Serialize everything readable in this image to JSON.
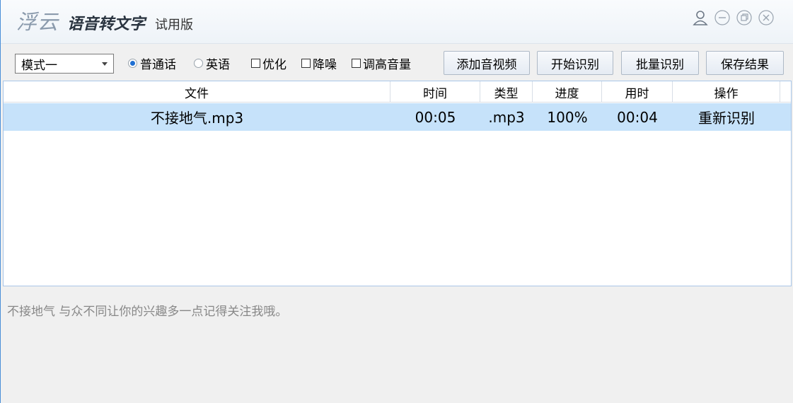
{
  "title_bar": {
    "logo": "浮云",
    "app_name": "语音转文字",
    "edition": "试用版",
    "controls": [
      "user-icon",
      "minimize-icon",
      "restore-icon",
      "close-icon"
    ]
  },
  "toolbar": {
    "mode_select": "模式一",
    "languages": [
      {
        "label": "普通话",
        "selected": true
      },
      {
        "label": "英语",
        "selected": false
      }
    ],
    "checkboxes": [
      {
        "label": "优化",
        "checked": false
      },
      {
        "label": "降噪",
        "checked": false
      },
      {
        "label": "调高音量",
        "checked": false
      }
    ],
    "buttons": {
      "add_media": "添加音视频",
      "start": "开始识别",
      "batch": "批量识别",
      "save": "保存结果"
    }
  },
  "table": {
    "columns": [
      "文件",
      "时间",
      "类型",
      "进度",
      "用时",
      "操作"
    ],
    "rows": [
      {
        "file": "不接地气.mp3",
        "time": "00:05",
        "type": ".mp3",
        "progress": "100%",
        "duration": "00:04",
        "action": "重新识别",
        "selected": true
      }
    ]
  },
  "result": {
    "text": "不接地气 与众不同让你的兴趣多一点记得关注我哦。"
  },
  "colors": {
    "selected_row": "#c6e2fa",
    "window_border": "#4a8fd8",
    "radio_dot": "#1f6fd2"
  }
}
